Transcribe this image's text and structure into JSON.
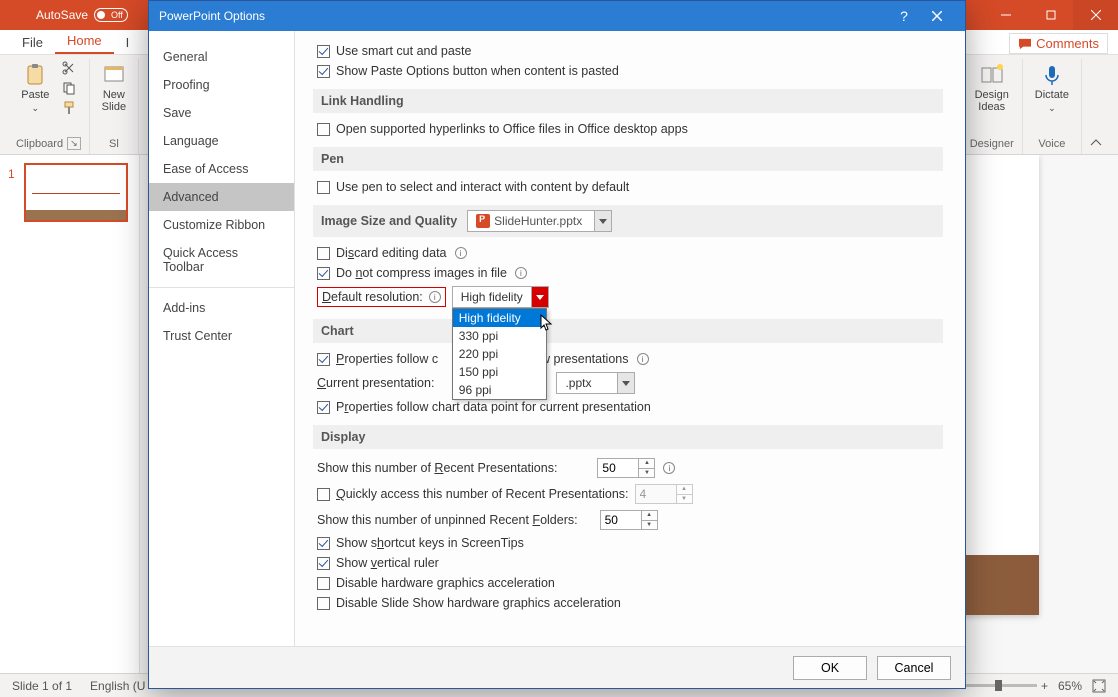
{
  "ppt": {
    "titlebar": {
      "autosave_label": "AutoSave",
      "autosave_state": "Off"
    },
    "tabs": {
      "file": "File",
      "home": "Home",
      "insert_initial": "I"
    },
    "ribbon": {
      "paste": "Paste",
      "paste_arrow": "⌄",
      "new_slide": "New\nSlide",
      "clipboard_label": "Clipboard",
      "sl_label": "Sl",
      "design_ideas": "Design\nIdeas",
      "designer_label": "Designer",
      "dictate": "Dictate",
      "voice_label": "Voice"
    },
    "comments": "Comments",
    "slide_num": "1",
    "status": {
      "slide": "Slide 1 of 1",
      "lang": "English (U",
      "zoom": "65%",
      "plus": "+"
    }
  },
  "dialog": {
    "title": "PowerPoint Options",
    "nav": {
      "general": "General",
      "proofing": "Proofing",
      "save": "Save",
      "language": "Language",
      "ease": "Ease of Access",
      "advanced": "Advanced",
      "customize": "Customize Ribbon",
      "qat": "Quick Access Toolbar",
      "addins": "Add-ins",
      "trust": "Trust Center"
    },
    "top": {
      "smart_cut": "Use smart cut and paste",
      "paste_options": "Show Paste Options button when content is pasted"
    },
    "link": {
      "head": "Link Handling",
      "open_links": "Open supported hyperlinks to Office files in Office desktop apps"
    },
    "pen": {
      "head": "Pen",
      "use_pen": "Use pen to select and interact with content by default"
    },
    "image": {
      "head": "Image Size and Quality",
      "file": "SlideHunter.pptx",
      "discard": "Discard editing data",
      "no_compress": "Do not compress images in file",
      "def_res_label": "Default resolution:",
      "def_res_value": "High fidelity",
      "dd": {
        "high": "High fidelity",
        "p330": "330 ppi",
        "p220": "220 ppi",
        "p150": "150 ppi",
        "p96": "96 ppi"
      }
    },
    "chart": {
      "head": "Chart",
      "prop_all_pre": "Properties follow c",
      "prop_all_post": " all new presentations",
      "cur_label": "Current presentation:",
      "cur_value": ".pptx",
      "prop_cur": "Properties follow chart data point for current presentation"
    },
    "display": {
      "head": "Display",
      "recent_pres_label": "Show this number of Recent Presentations:",
      "recent_pres_value": "50",
      "quick_label": "Quickly access this number of Recent Presentations:",
      "quick_value": "4",
      "folders_label": "Show this number of unpinned Recent Folders:",
      "folders_value": "50",
      "shortcuts": "Show shortcut keys in ScreenTips",
      "ruler": "Show vertical ruler",
      "hw_accel": "Disable hardware graphics acceleration",
      "ss_accel": "Disable Slide Show hardware graphics acceleration"
    },
    "footer": {
      "ok": "OK",
      "cancel": "Cancel"
    }
  }
}
